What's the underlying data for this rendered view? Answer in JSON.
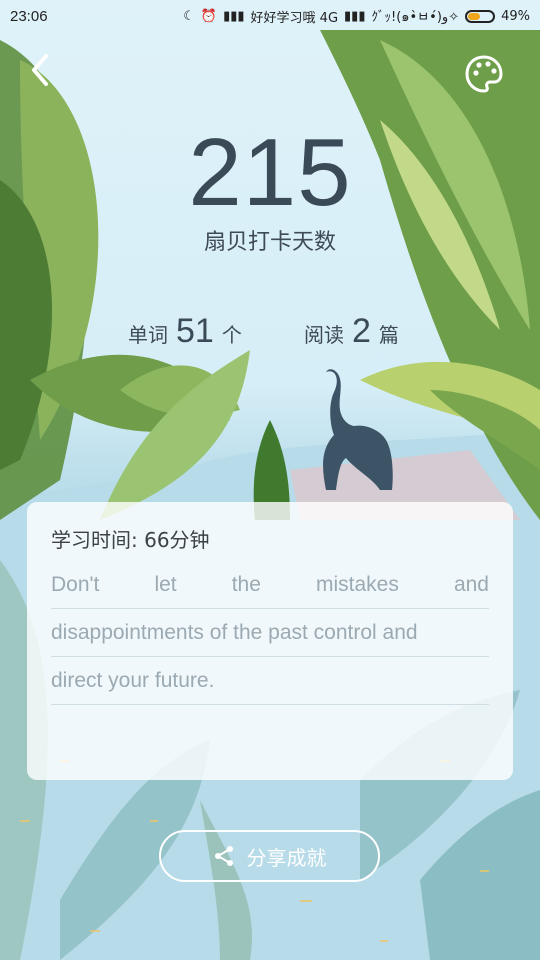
{
  "status_bar": {
    "time": "23:06",
    "carrier": "好好学习哦 4G",
    "extra": "ｸﾞｯ!(๑•̀ㅂ•́)و✧",
    "battery_percent": 49,
    "battery_label": "49%"
  },
  "header": {
    "back_icon": "chevron-left-icon",
    "theme_icon": "palette-icon"
  },
  "streak": {
    "days": "215",
    "label": "扇贝打卡天数"
  },
  "stats": {
    "words_prefix": "单词",
    "words_count": "51",
    "words_unit": "个",
    "reading_prefix": "阅读",
    "reading_count": "2",
    "reading_unit": "篇"
  },
  "card": {
    "study_time": "学习时间: 66分钟",
    "quote_line1_words": [
      "Don't",
      "let",
      "the",
      "mistakes",
      "and"
    ],
    "quote_line2": "disappointments of the past control and",
    "quote_line3": "direct your future."
  },
  "share": {
    "label": "分享成就",
    "icon": "share-icon"
  },
  "colors": {
    "text_dark": "#3a4a56",
    "battery": "#f0a61a",
    "quote": "#9aa9b2"
  }
}
